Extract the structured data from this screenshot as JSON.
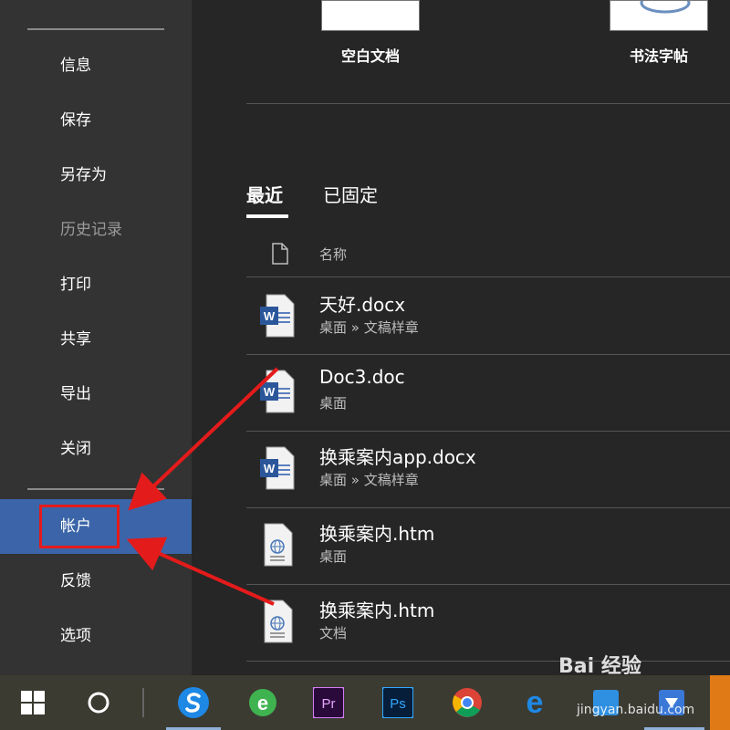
{
  "sidebar": {
    "items": [
      {
        "label": "信息"
      },
      {
        "label": "保存"
      },
      {
        "label": "另存为"
      },
      {
        "label": "历史记录"
      },
      {
        "label": "打印"
      },
      {
        "label": "共享"
      },
      {
        "label": "导出"
      },
      {
        "label": "关闭"
      },
      {
        "label": "帐户"
      },
      {
        "label": "反馈"
      },
      {
        "label": "选项"
      }
    ]
  },
  "templates": [
    {
      "label": "空白文档"
    },
    {
      "label": "书法字帖"
    }
  ],
  "tabs": [
    {
      "label": "最近"
    },
    {
      "label": "已固定"
    }
  ],
  "list": {
    "header": "名称",
    "files": [
      {
        "name": "天好.docx",
        "path": "桌面 » 文稿样章",
        "type": "word-icon"
      },
      {
        "name": "Doc3.doc",
        "path": "桌面",
        "type": "word-icon"
      },
      {
        "name": "换乘案内app.docx",
        "path": "桌面 » 文稿样章",
        "type": "word-icon"
      },
      {
        "name": "换乘案内.htm",
        "path": "桌面",
        "type": "web-document-icon"
      },
      {
        "name": "换乘案内.htm",
        "path": "文档",
        "type": "web-document-icon"
      }
    ]
  },
  "taskbar": {
    "icons": [
      "windows-start-icon",
      "cortana-icon",
      "sogou-icon",
      "ie-browser-icon",
      "premiere-icon",
      "photoshop-icon",
      "chrome-icon",
      "edge-icon",
      "app-icon",
      "app-icon"
    ]
  },
  "watermark": {
    "text": "Bai 经验",
    "sub": "jingyan.baidu.com"
  },
  "colors": {
    "accent": "#3b65a8",
    "highlight": "#e41b1b"
  }
}
